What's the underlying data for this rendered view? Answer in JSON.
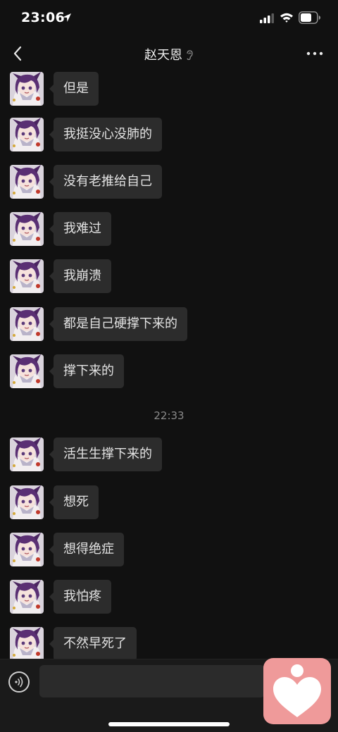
{
  "status_bar": {
    "time": "23:06"
  },
  "header": {
    "title": "赵天恩",
    "icons": [
      "back-chevron-icon",
      "earpiece-mode-icon",
      "more-options-icon"
    ]
  },
  "messages": [
    {
      "sender": "contact",
      "text": "但是"
    },
    {
      "sender": "contact",
      "text": "我挺没心没肺的"
    },
    {
      "sender": "contact",
      "text": "没有老推给自己"
    },
    {
      "sender": "contact",
      "text": "我难过"
    },
    {
      "sender": "contact",
      "text": "我崩溃"
    },
    {
      "sender": "contact",
      "text": "都是自己硬撑下来的"
    },
    {
      "sender": "contact",
      "text": "撑下来的"
    },
    {
      "sender": "contact",
      "text": "活生生撑下来的"
    },
    {
      "sender": "contact",
      "text": "想死"
    },
    {
      "sender": "contact",
      "text": "想得绝症"
    },
    {
      "sender": "contact",
      "text": "我怕疼"
    },
    {
      "sender": "contact",
      "text": "不然早死了"
    }
  ],
  "timestamp_separator": "22:33",
  "input_bar": {
    "placeholder": "",
    "icons": [
      "voice-input-icon"
    ]
  },
  "overlay_widget": {
    "icon": "heart-figure-icon",
    "color": "#ef9a9a"
  },
  "colors": {
    "background": "#111111",
    "bubble": "#2c2c2c",
    "bubble_text": "#e3e3e3"
  }
}
